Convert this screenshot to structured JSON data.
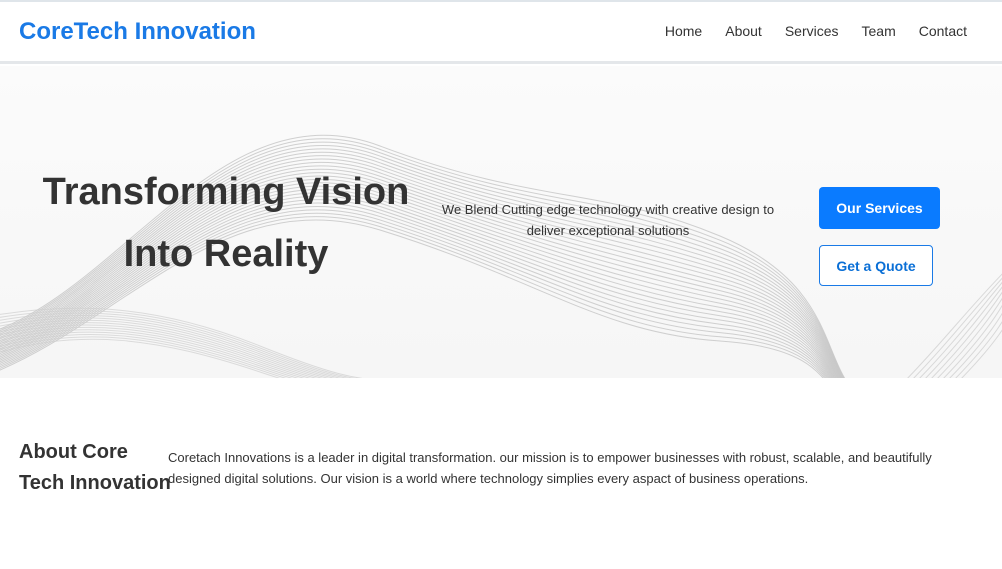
{
  "brand": {
    "name": "CoreTech Innovation"
  },
  "nav": {
    "items": [
      {
        "label": "Home"
      },
      {
        "label": "About"
      },
      {
        "label": "Services"
      },
      {
        "label": "Team"
      },
      {
        "label": "Contact"
      }
    ]
  },
  "hero": {
    "title_line1": "Transforming Vision",
    "title_line2": "Into Reality",
    "tagline": "We Blend Cutting edge technology with creative design to deliver exceptional solutions",
    "primary_button": "Our Services",
    "secondary_button": "Get a Quote"
  },
  "about": {
    "heading_line1": "About Core",
    "heading_line2": "Tech Innovation",
    "text": "Coretach Innovations is a leader in digital transformation. our mission is to empower businesses with robust, scalable, and beautifully designed digital solutions. Our vision is a world where technology simplies every aspact of business operations."
  },
  "colors": {
    "brand": "#1a7ae6",
    "primary_button": "#0a7bff",
    "text": "#333333",
    "hero_background": "#f8f8f8",
    "wave_lines": "#c4c4c4"
  }
}
